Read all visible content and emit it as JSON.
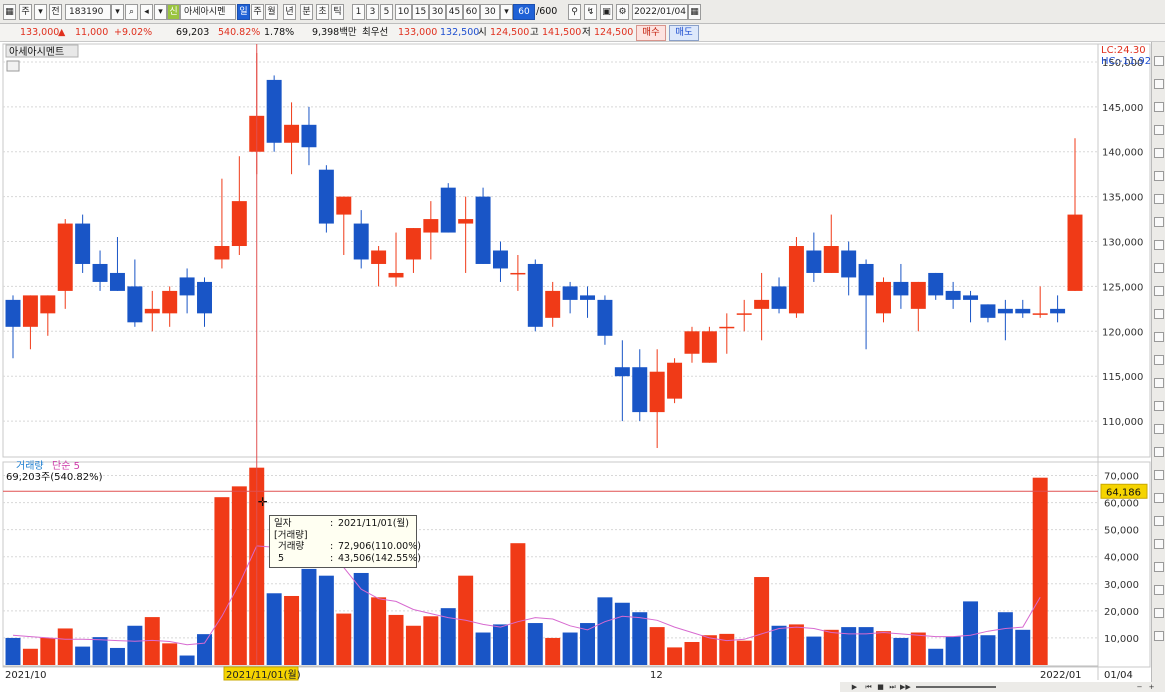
{
  "toolbar": {
    "market_items": [
      "주",
      "전"
    ],
    "code": "183190",
    "stock_name": "아세아시멘",
    "period_active": "일",
    "periods": [
      "주",
      "월",
      "년",
      "분",
      "초",
      "틱"
    ],
    "intervals": [
      "1",
      "3",
      "5",
      "10",
      "15",
      "30",
      "45",
      "60"
    ],
    "interval_value": "30",
    "count_value": "60",
    "count_max": "/600",
    "date": "2022/01/04"
  },
  "quote": {
    "price": "133,000",
    "change_arrow": "▲",
    "change": "11,000",
    "change_pct": "+9.02%",
    "volume": "69,203",
    "volume_ratio": "540.82%",
    "turnover": "1.78%",
    "amount": "9,398백만",
    "priority_label": "최우선",
    "ask": "133,000",
    "bid": "132,500",
    "open_label": "시",
    "open": "124,500",
    "high_label": "고",
    "high": "141,500",
    "low_label": "저",
    "low": "124,500",
    "buy_label": "매수",
    "sell_label": "매도"
  },
  "chart_data": {
    "type": "candlestick",
    "title": "아세아시멘트",
    "lc_label": "LC:24.30",
    "hc_label": "HC:-11.92",
    "price_ylim": [
      106000,
      152000
    ],
    "price_ticks": [
      "150,000",
      "145,000",
      "140,000",
      "135,000",
      "130,000",
      "125,000",
      "120,000",
      "115,000",
      "110,000"
    ],
    "price_tick_values": [
      150000,
      145000,
      140000,
      135000,
      130000,
      125000,
      120000,
      115000,
      110000
    ],
    "candles": [
      {
        "o": 123500,
        "h": 124000,
        "l": 117000,
        "c": 120500
      },
      {
        "o": 120500,
        "h": 124000,
        "l": 118000,
        "c": 124000
      },
      {
        "o": 122000,
        "h": 124000,
        "l": 119500,
        "c": 124000
      },
      {
        "o": 124500,
        "h": 132500,
        "l": 122500,
        "c": 132000
      },
      {
        "o": 132000,
        "h": 133000,
        "l": 126500,
        "c": 127500
      },
      {
        "o": 127500,
        "h": 129000,
        "l": 124500,
        "c": 125500
      },
      {
        "o": 126500,
        "h": 130500,
        "l": 124500,
        "c": 124500
      },
      {
        "o": 125000,
        "h": 128000,
        "l": 120500,
        "c": 121000
      },
      {
        "o": 122000,
        "h": 124500,
        "l": 120000,
        "c": 122500
      },
      {
        "o": 122000,
        "h": 125000,
        "l": 120500,
        "c": 124500
      },
      {
        "o": 126000,
        "h": 127000,
        "l": 122000,
        "c": 124000
      },
      {
        "o": 125500,
        "h": 126000,
        "l": 120500,
        "c": 122000
      },
      {
        "o": 128000,
        "h": 137000,
        "l": 127000,
        "c": 129500
      },
      {
        "o": 129500,
        "h": 139500,
        "l": 128500,
        "c": 134500
      },
      {
        "o": 140000,
        "h": 151000,
        "l": 137500,
        "c": 144000
      },
      {
        "o": 148000,
        "h": 148500,
        "l": 140000,
        "c": 141000
      },
      {
        "o": 141000,
        "h": 145500,
        "l": 137500,
        "c": 143000
      },
      {
        "o": 143000,
        "h": 145000,
        "l": 138500,
        "c": 140500
      },
      {
        "o": 138000,
        "h": 138500,
        "l": 131000,
        "c": 132000
      },
      {
        "o": 133000,
        "h": 135000,
        "l": 128500,
        "c": 135000
      },
      {
        "o": 132000,
        "h": 133500,
        "l": 127000,
        "c": 128000
      },
      {
        "o": 127500,
        "h": 129500,
        "l": 125000,
        "c": 129000
      },
      {
        "o": 126000,
        "h": 131000,
        "l": 125000,
        "c": 126500
      },
      {
        "o": 128000,
        "h": 131500,
        "l": 126500,
        "c": 131500
      },
      {
        "o": 131000,
        "h": 134500,
        "l": 128000,
        "c": 132500
      },
      {
        "o": 136000,
        "h": 136500,
        "l": 131000,
        "c": 131000
      },
      {
        "o": 132000,
        "h": 135000,
        "l": 126500,
        "c": 132500
      },
      {
        "o": 135000,
        "h": 136000,
        "l": 127500,
        "c": 127500
      },
      {
        "o": 129000,
        "h": 130000,
        "l": 125500,
        "c": 127000
      },
      {
        "o": 126500,
        "h": 128500,
        "l": 124500,
        "c": 126500
      },
      {
        "o": 127500,
        "h": 128000,
        "l": 120000,
        "c": 120500
      },
      {
        "o": 121500,
        "h": 125500,
        "l": 120500,
        "c": 124500
      },
      {
        "o": 125000,
        "h": 125500,
        "l": 122000,
        "c": 123500
      },
      {
        "o": 124000,
        "h": 125000,
        "l": 121500,
        "c": 123500
      },
      {
        "o": 123500,
        "h": 124000,
        "l": 118500,
        "c": 119500
      },
      {
        "o": 116000,
        "h": 119000,
        "l": 110000,
        "c": 115000
      },
      {
        "o": 116000,
        "h": 118000,
        "l": 110000,
        "c": 111000
      },
      {
        "o": 111000,
        "h": 118000,
        "l": 107000,
        "c": 115500
      },
      {
        "o": 112500,
        "h": 117000,
        "l": 112000,
        "c": 116500
      },
      {
        "o": 117500,
        "h": 120500,
        "l": 116500,
        "c": 120000
      },
      {
        "o": 116500,
        "h": 120500,
        "l": 116500,
        "c": 120000
      },
      {
        "o": 120500,
        "h": 122000,
        "l": 117500,
        "c": 120500
      },
      {
        "o": 122000,
        "h": 123500,
        "l": 120000,
        "c": 122000
      },
      {
        "o": 122500,
        "h": 126500,
        "l": 119000,
        "c": 123500
      },
      {
        "o": 125000,
        "h": 126000,
        "l": 122000,
        "c": 122500
      },
      {
        "o": 122000,
        "h": 130500,
        "l": 121500,
        "c": 129500
      },
      {
        "o": 129000,
        "h": 131000,
        "l": 125500,
        "c": 126500
      },
      {
        "o": 126500,
        "h": 133000,
        "l": 126500,
        "c": 129500
      },
      {
        "o": 129000,
        "h": 130000,
        "l": 124000,
        "c": 126000
      },
      {
        "o": 127500,
        "h": 128000,
        "l": 118000,
        "c": 124000
      },
      {
        "o": 122000,
        "h": 126000,
        "l": 121000,
        "c": 125500
      },
      {
        "o": 125500,
        "h": 127500,
        "l": 122500,
        "c": 124000
      },
      {
        "o": 122500,
        "h": 125500,
        "l": 120000,
        "c": 125500
      },
      {
        "o": 126500,
        "h": 126500,
        "l": 123500,
        "c": 124000
      },
      {
        "o": 124500,
        "h": 125500,
        "l": 122500,
        "c": 123500
      },
      {
        "o": 124000,
        "h": 124500,
        "l": 121000,
        "c": 123500
      },
      {
        "o": 123000,
        "h": 123000,
        "l": 121000,
        "c": 121500
      },
      {
        "o": 122500,
        "h": 123500,
        "l": 119000,
        "c": 122000
      },
      {
        "o": 122500,
        "h": 123500,
        "l": 121500,
        "c": 122000
      },
      {
        "o": 122000,
        "h": 125000,
        "l": 121500,
        "c": 122000
      },
      {
        "o": 122500,
        "h": 124000,
        "l": 121000,
        "c": 122000
      },
      {
        "o": 124500,
        "h": 141500,
        "l": 124500,
        "c": 133000
      }
    ],
    "volume_label": "거래량",
    "ma_label": "단순 5",
    "volume_readout": "69,203주(540.82%)",
    "volume_ylim": [
      0,
      75000
    ],
    "volume_ticks": [
      "70,000",
      "60,000",
      "50,000",
      "40,000",
      "30,000",
      "20,000",
      "10,000"
    ],
    "volume_tick_values": [
      70000,
      60000,
      50000,
      40000,
      30000,
      20000,
      10000
    ],
    "volume_line": 64186,
    "volume_line_label": "64,186",
    "volumes": [
      10000,
      6000,
      10000,
      13500,
      6800,
      10300,
      6300,
      14500,
      17700,
      8000,
      3500,
      11400,
      62000,
      66000,
      72906,
      26500,
      25500,
      35500,
      33000,
      19000,
      34000,
      25000,
      18500,
      14500,
      18000,
      21000,
      33000,
      12000,
      15000,
      45000,
      15500,
      10000,
      12000,
      15500,
      25000,
      23000,
      19500,
      14000,
      6500,
      8500,
      11000,
      11500,
      9000,
      32500,
      14500,
      15000,
      10500,
      13000,
      14000,
      14000,
      12500,
      10000,
      12000,
      6000,
      10500,
      23500,
      11000,
      19500,
      13000,
      69203
    ],
    "ma5": [
      11000,
      10500,
      10000,
      9500,
      9500,
      9300,
      9000,
      8800,
      9100,
      8700,
      7500,
      8100,
      18000,
      30000,
      44000,
      43500,
      47000,
      49000,
      43000,
      36000,
      28000,
      24500,
      23500,
      20500,
      19000,
      17500,
      16500,
      15000,
      14000,
      16000,
      17500,
      17000,
      14500,
      13000,
      16000,
      18000,
      17500,
      16500,
      14000,
      12000,
      10000,
      9000,
      9500,
      11500,
      13500,
      14000,
      13500,
      12000,
      11500,
      11500,
      12000,
      11500,
      11000,
      10500,
      10500,
      11000,
      12500,
      13500,
      14000,
      25000
    ],
    "x_labels": [
      "2021/10",
      "2021/11/01(월)",
      "12",
      "2022/01",
      "01/04"
    ],
    "tooltip": {
      "date_key": "일자",
      "date_val": "2021/11/01(월)",
      "section": "[거래량]",
      "vol_key": "거래량",
      "vol_val": "72,906(110.00%)",
      "ma_key": "5",
      "ma_val": "43,506(142.55%)"
    },
    "up_color": "#f03a17",
    "down_color": "#1955c6",
    "ma_color": "#d76ad0",
    "line_color": "#e05050"
  }
}
